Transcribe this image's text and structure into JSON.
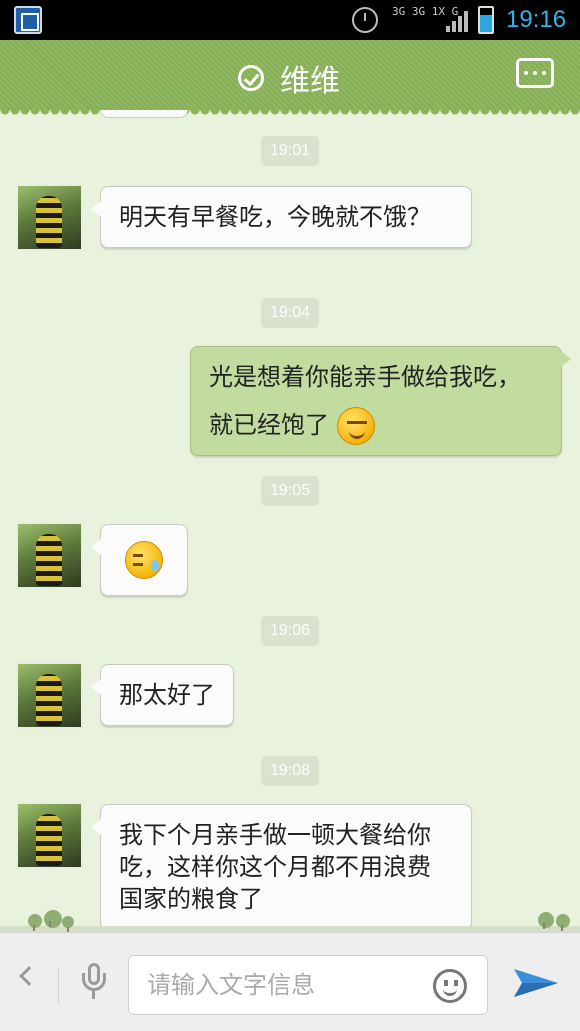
{
  "status_bar": {
    "network_labels": "3G 3G 1X G",
    "time": "19:16",
    "colors": {
      "time": "#33b5e5",
      "battery": "#2ea7e0"
    },
    "icons": [
      "app-notification-icon",
      "alarm-icon",
      "signal-icon",
      "battery-icon"
    ]
  },
  "header": {
    "title": "维维",
    "icons": [
      "verified-check-icon",
      "more-icon"
    ],
    "color": "#8ab45a"
  },
  "messages": [
    {
      "timestamp": "19:01",
      "direction": "in",
      "text": "明天有早餐吃，今晚就不饿？"
    },
    {
      "timestamp": "19:04",
      "direction": "out",
      "text": "光是想着你能亲手做给我吃，就已经饱了",
      "emoji": "smile-emoji"
    },
    {
      "timestamp": "19:05",
      "direction": "in",
      "text": "",
      "emoji": "sweat-emoji"
    },
    {
      "timestamp": "19:06",
      "direction": "in",
      "text": "那太好了"
    },
    {
      "timestamp": "19:08",
      "direction": "in",
      "text": "我下个月亲手做一顿大餐给你吃，这样你这个月都不用浪费国家的粮食了"
    }
  ],
  "input_bar": {
    "placeholder": "请输入文字信息",
    "icons": [
      "back-chevron-icon",
      "microphone-icon",
      "emoji-icon",
      "send-icon"
    ]
  }
}
